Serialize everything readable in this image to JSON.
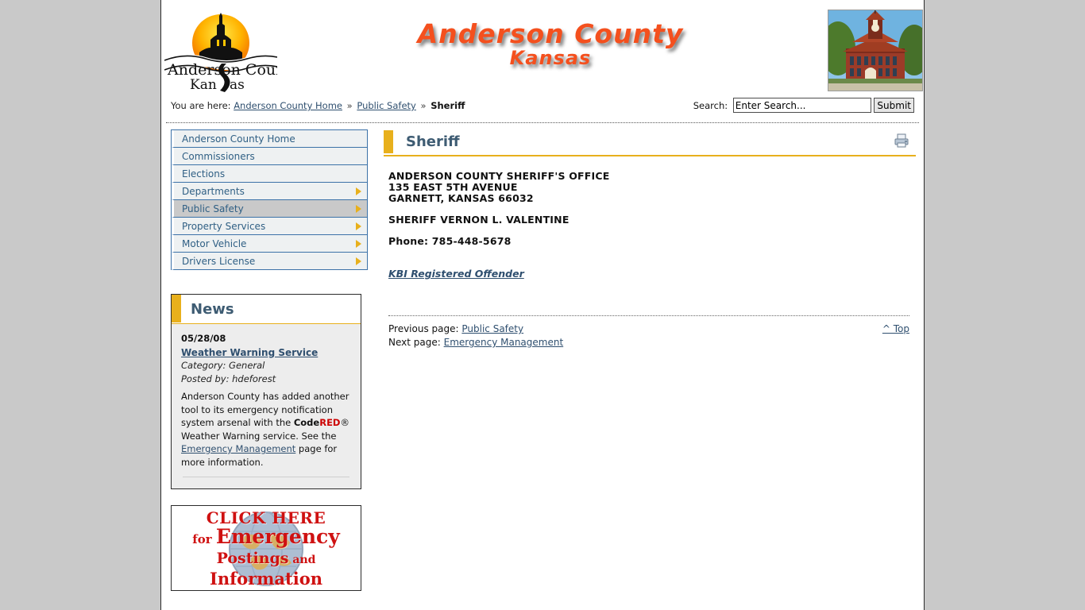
{
  "header": {
    "logo_alt": "Anderson County Kansas",
    "logo_text_line1": "Anderson County",
    "logo_text_line2": "Kansas",
    "banner_line1": "Anderson County",
    "banner_line2": "Kansas",
    "photo_alt": "Anderson County Courthouse",
    "accent_color": "#e8b01c",
    "banner_color": "#f4501e",
    "heading_color": "#3e5c73",
    "link_color": "#2f4f6f"
  },
  "breadcrumb": {
    "prefix": "You are here:",
    "items": [
      {
        "label": "Anderson County Home",
        "link": true
      },
      {
        "label": "Public Safety",
        "link": true
      },
      {
        "label": "Sheriff",
        "link": false
      }
    ],
    "separator": "»"
  },
  "search": {
    "label": "Search:",
    "value": "Enter Search...",
    "placeholder": "Enter Search...",
    "submit_label": "Submit"
  },
  "sidebar": {
    "items": [
      {
        "label": "Anderson County Home",
        "arrow": false,
        "active": false
      },
      {
        "label": "Commissioners",
        "arrow": false,
        "active": false
      },
      {
        "label": "Elections",
        "arrow": false,
        "active": false
      },
      {
        "label": "Departments",
        "arrow": true,
        "active": false
      },
      {
        "label": "Public Safety",
        "arrow": true,
        "active": true
      },
      {
        "label": "Property Services",
        "arrow": true,
        "active": false
      },
      {
        "label": "Motor Vehicle",
        "arrow": true,
        "active": false
      },
      {
        "label": "Drivers License",
        "arrow": true,
        "active": false
      }
    ]
  },
  "news": {
    "title": "News",
    "date": "05/28/08",
    "headline": "Weather Warning Service",
    "category": "Category: General",
    "posted_by": "Posted by: hdeforest",
    "body_part1": "Anderson County has added another tool to its emergency notification system arsenal with the ",
    "code_black": "Code",
    "code_red": "RED",
    "registered": "®",
    "body_part2": " Weather Warning service. See the",
    "inline_link": " Emergency Management",
    "body_part3": " page for more information."
  },
  "emergency_banner": {
    "line1": "CLICK HERE",
    "line2_small": "for ",
    "line2_big": "Emergency",
    "line3_big": "Postings",
    "line3_small": " and",
    "line4": "Information"
  },
  "main": {
    "page_title": "Sheriff",
    "print_icon": "printer-icon",
    "office_name": "ANDERSON COUNTY SHERIFF'S OFFICE",
    "address_line": "135 EAST 5TH AVENUE",
    "city_line": "GARNETT, KANSAS 66032",
    "sheriff_name": "SHERIFF VERNON L. VALENTINE",
    "phone": "Phone:  785-448-5678",
    "kbi_link": "KBI Registered Offender"
  },
  "pager": {
    "previous_label": "Previous page:",
    "previous_link": "Public Safety",
    "next_label": "Next page:",
    "next_link": "Emergency Management",
    "top_label": "^ Top"
  }
}
